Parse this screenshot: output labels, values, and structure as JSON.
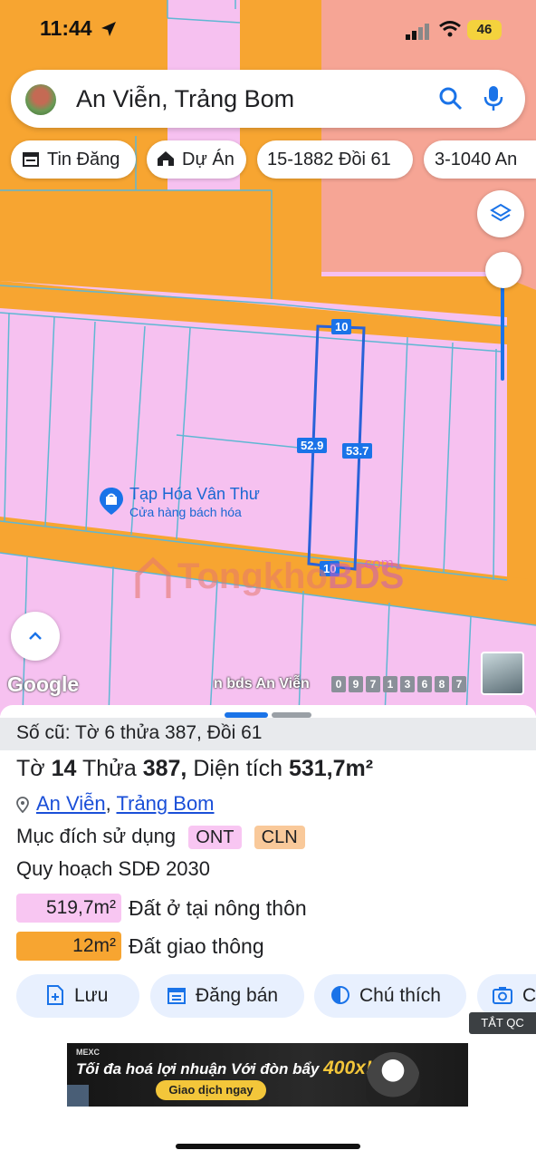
{
  "status": {
    "time": "11:44",
    "battery": "46"
  },
  "search": {
    "query": "An Viễn, Trảng Bom"
  },
  "chips": [
    {
      "label": "Tin Đăng",
      "icon": "calendar-icon"
    },
    {
      "label": "Dự Án",
      "icon": "house-icon"
    },
    {
      "label": "15-1882 Đồi 61"
    },
    {
      "label": "3-1040 An"
    }
  ],
  "map": {
    "dimensions": {
      "top": "10",
      "left": "52.9",
      "right": "53.7",
      "bottom": "10"
    },
    "poi": {
      "name": "Tạp Hóa Vân Thư",
      "subtitle": "Cửa hàng bách hóa"
    },
    "watermark": {
      "a": "Tongkho",
      "b": "BDS",
      "c": ".com"
    },
    "google_logo": "Google",
    "ticker_text": "n bds An Viễn",
    "ticker_digits": [
      "0",
      "9",
      "7",
      "1",
      "3",
      "6",
      "8",
      "7"
    ]
  },
  "sheet": {
    "old_ref": "Số cũ: Tờ 6 thửa 387, Đồi 61",
    "line1": {
      "to_label": "Tờ",
      "to": "14",
      "thua_label": "Thửa",
      "thua": "387,",
      "area_label": "Diện tích",
      "area": "531,7m²"
    },
    "address": {
      "ward": "An Viễn",
      "sep": ",",
      "district": "Trảng Bom"
    },
    "purpose": {
      "label": "Mục đích sử dụng",
      "tags": [
        "ONT",
        "CLN"
      ]
    },
    "plan_title": "Quy hoạch SDĐ 2030",
    "plan_items": [
      {
        "value": "519,7m²",
        "label": "Đất ở tại nông thôn",
        "color": "#f8c6f2"
      },
      {
        "value": "12m²",
        "label": "Đất giao thông",
        "color": "#f7a531"
      }
    ],
    "actions": [
      {
        "label": "Lưu",
        "icon": "add-file-icon"
      },
      {
        "label": "Đăng bán",
        "icon": "calendar-icon"
      },
      {
        "label": "Chú thích",
        "icon": "contrast-icon"
      },
      {
        "label": "C",
        "icon": "camera-icon"
      }
    ],
    "ad_close": "TẮT QC"
  },
  "ad": {
    "brand": "MEXC",
    "headline": "Tối đa hoá lợi nhuận Với đòn bẩy",
    "big": "400x!",
    "cta": "Giao dịch ngay"
  },
  "colors": {
    "accent": "#1a73e8",
    "residential": "#f8c6f2",
    "road": "#f7a531",
    "action_bg": "#e8f0fe"
  }
}
